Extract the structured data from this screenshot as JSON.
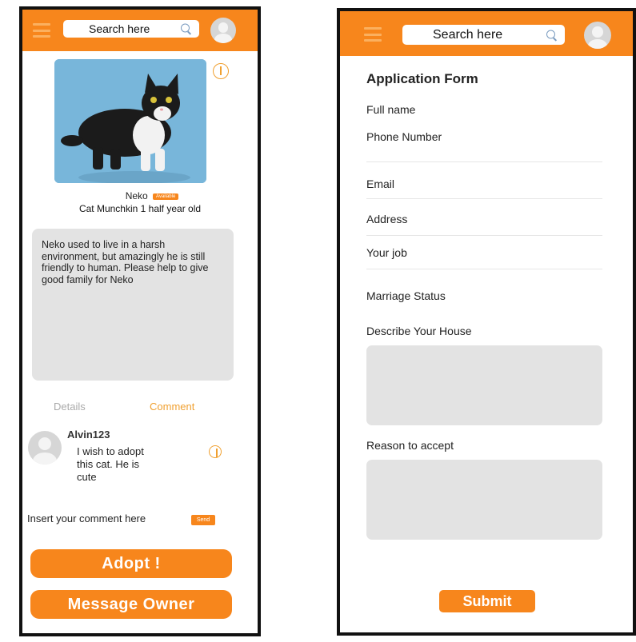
{
  "left_screen": {
    "topbar": {
      "search_placeholder": "Search here",
      "accent": "#f7861c"
    },
    "pet": {
      "name": "Neko",
      "status_badge": "Available",
      "breed_age": "Cat Munchkin 1 half year old",
      "description": "Neko used to live in a harsh environment, but amazingly he is still friendly to human. Please help to give good family for Neko"
    },
    "tabs": [
      {
        "label": "Details"
      },
      {
        "label": "Comment"
      }
    ],
    "comment": {
      "user": "Alvin123",
      "text": "I wish to adopt this cat. He is cute"
    },
    "comment_input_placeholder": "Insert your comment here",
    "send_label": "Send",
    "adopt_label": "Adopt !",
    "message_owner_label": "Message Owner"
  },
  "right_screen": {
    "topbar": {
      "search_placeholder": "Search here"
    },
    "form_title": "Application Form",
    "fields": {
      "full_name": "Full name",
      "phone": "Phone Number",
      "email": "Email",
      "address": "Address",
      "job": "Your job",
      "marriage": "Marriage Status",
      "house": "Describe Your House",
      "reason": "Reason to accept"
    },
    "submit_label": "Submit"
  }
}
